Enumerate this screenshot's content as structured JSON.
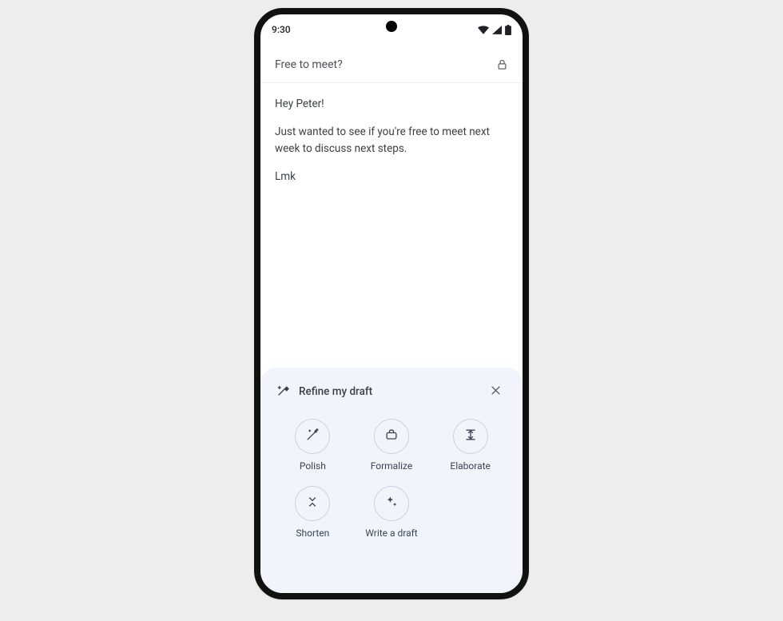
{
  "status": {
    "time": "9:30"
  },
  "compose": {
    "subject": "Free to meet?",
    "body": {
      "p1": "Hey Peter!",
      "p2": "Just wanted to see if you're free to meet next week to discuss next steps.",
      "p3": "Lmk"
    }
  },
  "panel": {
    "title": "Refine my draft",
    "options": {
      "polish": "Polish",
      "formalize": "Formalize",
      "elaborate": "Elaborate",
      "shorten": "Shorten",
      "write": "Write a draft"
    }
  }
}
